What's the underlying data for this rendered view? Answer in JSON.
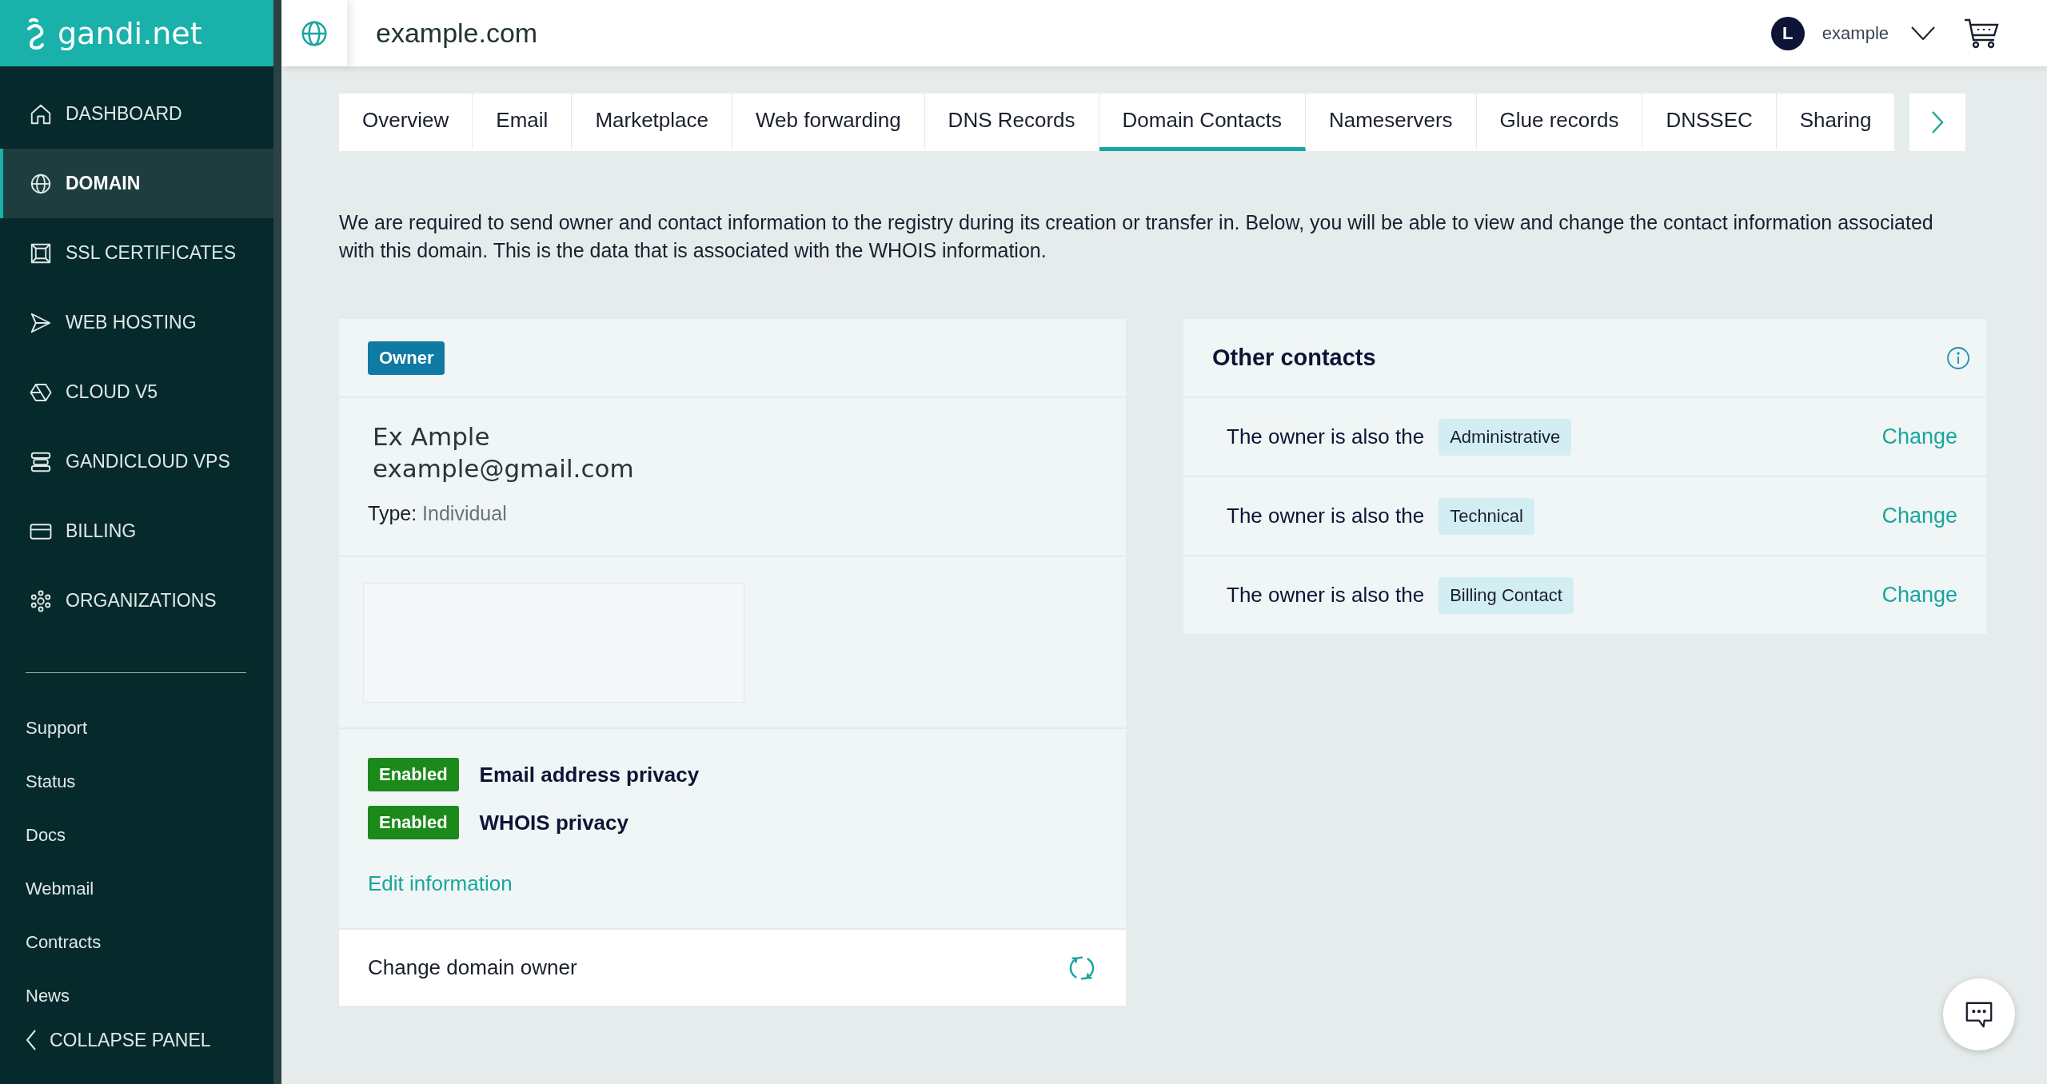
{
  "brand": {
    "name": "gandi.net"
  },
  "sidebar": {
    "items": [
      {
        "label": "DASHBOARD",
        "selected": false
      },
      {
        "label": "DOMAIN",
        "selected": true
      },
      {
        "label": "SSL CERTIFICATES",
        "selected": false
      },
      {
        "label": "WEB HOSTING",
        "selected": false
      },
      {
        "label": "CLOUD V5",
        "selected": false
      },
      {
        "label": "GANDICLOUD VPS",
        "selected": false
      },
      {
        "label": "BILLING",
        "selected": false
      },
      {
        "label": "ORGANIZATIONS",
        "selected": false
      }
    ],
    "links": [
      "Support",
      "Status",
      "Docs",
      "Webmail",
      "Contracts",
      "News"
    ],
    "collapse": "COLLAPSE PANEL"
  },
  "header": {
    "domain": "example.com",
    "user": {
      "initial": "L",
      "name": "example"
    }
  },
  "tabs": [
    {
      "label": "Overview",
      "selected": false
    },
    {
      "label": "Email",
      "selected": false
    },
    {
      "label": "Marketplace",
      "selected": false
    },
    {
      "label": "Web forwarding",
      "selected": false
    },
    {
      "label": "DNS Records",
      "selected": false
    },
    {
      "label": "Domain Contacts",
      "selected": true
    },
    {
      "label": "Nameservers",
      "selected": false
    },
    {
      "label": "Glue records",
      "selected": false
    },
    {
      "label": "DNSSEC",
      "selected": false
    },
    {
      "label": "Sharing",
      "selected": false
    }
  ],
  "description": "We are required to send owner and contact information to the registry during its creation or transfer in. Below, you will be able to view and change the contact information associated with this domain. This is the data that is associated with the WHOIS information.",
  "owner": {
    "badge": "Owner",
    "name": "Ex Ample",
    "email": "example@gmail.com",
    "type_label": "Type:",
    "type_value": "Individual",
    "privacy": [
      {
        "status": "Enabled",
        "label": "Email address privacy"
      },
      {
        "status": "Enabled",
        "label": "WHOIS privacy"
      }
    ],
    "edit_link": "Edit information",
    "change_owner": "Change domain owner"
  },
  "other_contacts": {
    "title": "Other contacts",
    "rows": [
      {
        "text": "The owner is also the",
        "role": "Administrative",
        "action": "Change"
      },
      {
        "text": "The owner is also the",
        "role": "Technical",
        "action": "Change"
      },
      {
        "text": "The owner is also the",
        "role": "Billing Contact",
        "action": "Change"
      }
    ]
  }
}
